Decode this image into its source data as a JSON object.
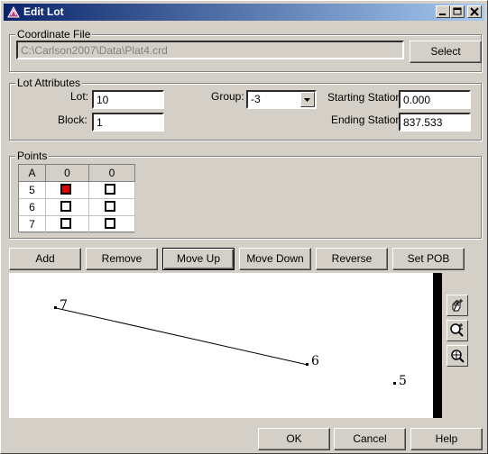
{
  "window": {
    "title": "Edit Lot"
  },
  "coordinate_file": {
    "group_label": "Coordinate File",
    "path": "C:\\Carlson2007\\Data\\Plat4.crd",
    "select_label": "Select"
  },
  "lot_attributes": {
    "group_label": "Lot Attributes",
    "lot_label": "Lot:",
    "lot_value": "10",
    "block_label": "Block:",
    "block_value": "1",
    "group_field_label": "Group:",
    "group_value": "-3",
    "starting_station_label": "Starting Station:",
    "starting_station_value": "0.000",
    "ending_station_label": "Ending Station:",
    "ending_station_value": "837.533"
  },
  "points": {
    "group_label": "Points",
    "headers": [
      "A",
      "0",
      "0"
    ],
    "rows": [
      {
        "id": "5",
        "col1_checked": true,
        "col2_checked": false
      },
      {
        "id": "6",
        "col1_checked": false,
        "col2_checked": false
      },
      {
        "id": "7",
        "col1_checked": false,
        "col2_checked": false
      }
    ]
  },
  "actions": {
    "add": "Add",
    "remove": "Remove",
    "move_up": "Move Up",
    "move_down": "Move Down",
    "reverse": "Reverse",
    "set_pob": "Set POB"
  },
  "plot": {
    "labels": {
      "p7": "7",
      "p6": "6",
      "p5": "5"
    }
  },
  "tools": [
    "pan-hand-icon",
    "zoom-in-out-icon",
    "zoom-extents-icon"
  ],
  "footer": {
    "ok": "OK",
    "cancel": "Cancel",
    "help": "Help"
  }
}
